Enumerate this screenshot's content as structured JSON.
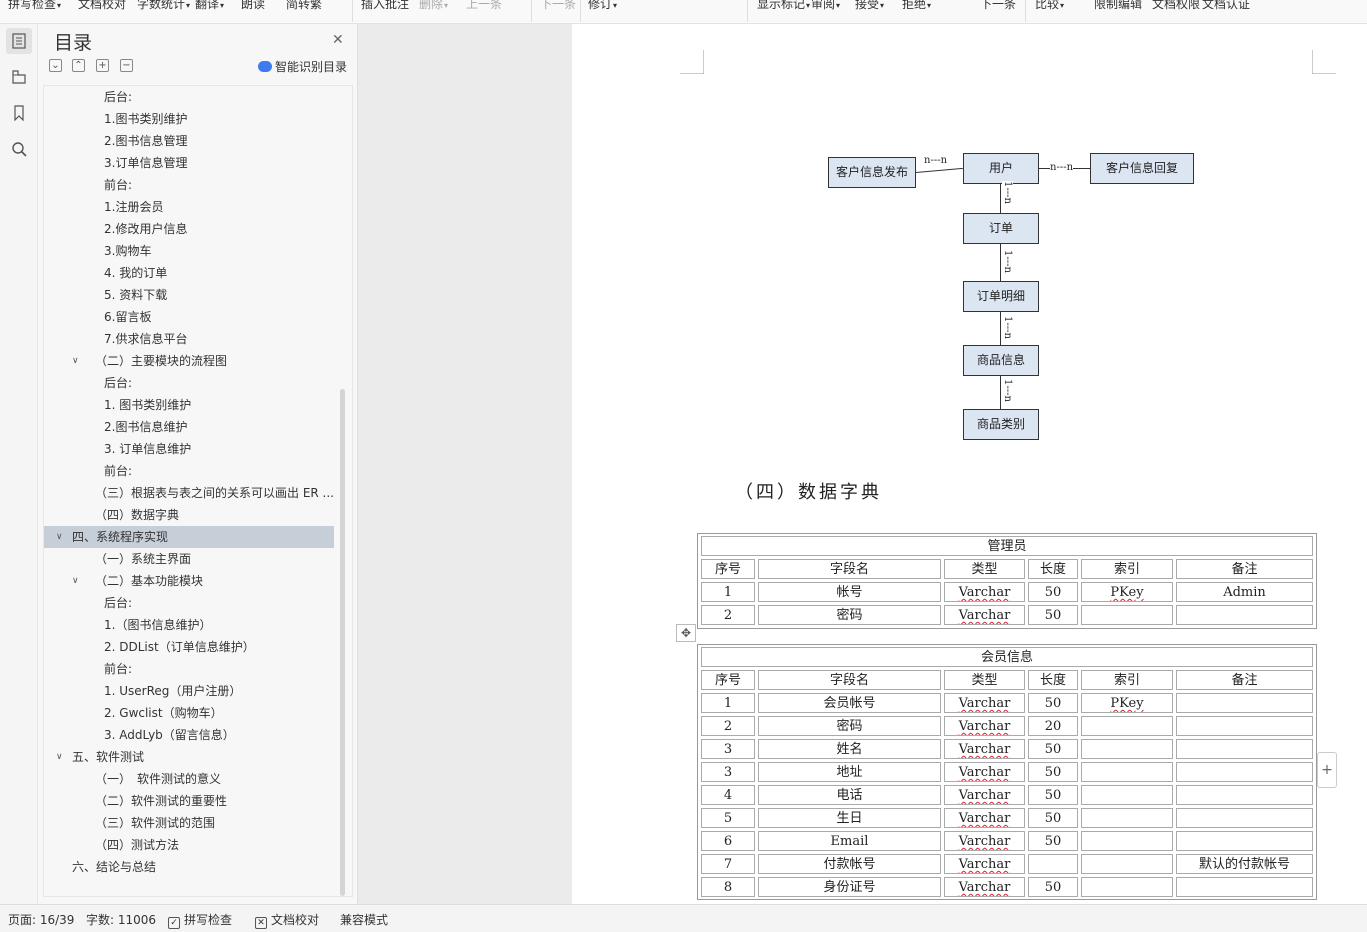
{
  "toolbar": {
    "items": [
      "拼写检查",
      "文档校对",
      "字数统计",
      "翻译",
      "朗读",
      "简转繁",
      "插入批注",
      "删除",
      "上一条",
      "下一条",
      "修订",
      "显示标记",
      "审阅",
      "接受",
      "拒绝",
      "下一条",
      "比较",
      "限制编辑",
      "文档权限",
      "文档认证"
    ]
  },
  "toc": {
    "title": "目录",
    "smart_label": "智能识别目录",
    "items": [
      {
        "text": "后台:",
        "level": 3
      },
      {
        "text": "1.图书类别维护",
        "level": 3
      },
      {
        "text": "2.图书信息管理",
        "level": 3
      },
      {
        "text": "3.订单信息管理",
        "level": 3
      },
      {
        "text": "前台:",
        "level": 3
      },
      {
        "text": "1.注册会员",
        "level": 3
      },
      {
        "text": "2.修改用户信息",
        "level": 3
      },
      {
        "text": "3.购物车",
        "level": 3
      },
      {
        "text": "4. 我的订单",
        "level": 3
      },
      {
        "text": "5. 资料下载",
        "level": 3
      },
      {
        "text": "6.留言板",
        "level": 3
      },
      {
        "text": "7.供求信息平台",
        "level": 3
      },
      {
        "text": "（二）主要模块的流程图",
        "level": 2,
        "expand": true
      },
      {
        "text": "后台:",
        "level": 3
      },
      {
        "text": "1. 图书类别维护",
        "level": 3
      },
      {
        "text": "2.图书信息维护",
        "level": 3
      },
      {
        "text": "3. 订单信息维护",
        "level": 3
      },
      {
        "text": "前台:",
        "level": 3
      },
      {
        "text": "（三）根据表与表之间的关系可以画出 ER ...",
        "level": 2
      },
      {
        "text": "（四）数据字典",
        "level": 2
      },
      {
        "text": "四、系统程序实现",
        "level": 1,
        "expand": true,
        "selected": true
      },
      {
        "text": "（一）系统主界面",
        "level": 2
      },
      {
        "text": "（二）基本功能模块",
        "level": 2,
        "expand": true
      },
      {
        "text": "后台:",
        "level": 3
      },
      {
        "text": "1.（图书信息维护）",
        "level": 3
      },
      {
        "text": "2. DDList（订单信息维护）",
        "level": 3
      },
      {
        "text": "前台:",
        "level": 3
      },
      {
        "text": "1. UserReg（用户注册）",
        "level": 3
      },
      {
        "text": "2. Gwclist（购物车）",
        "level": 3
      },
      {
        "text": "3. AddLyb（留言信息）",
        "level": 3
      },
      {
        "text": "五、软件测试",
        "level": 1,
        "expand": true
      },
      {
        "text": "（一）　软件测试的意义",
        "level": 2
      },
      {
        "text": "（二）软件测试的重要性",
        "level": 2
      },
      {
        "text": "（三）软件测试的范围",
        "level": 2
      },
      {
        "text": "（四）测试方法",
        "level": 2
      },
      {
        "text": "六、结论与总结",
        "level": 1
      }
    ]
  },
  "er": {
    "boxes": {
      "customer_post": "客户信息发布",
      "user": "用户",
      "customer_reply": "客户信息回复",
      "order": "订单",
      "order_detail": "订单明细",
      "product_info": "商品信息",
      "product_category": "商品类别"
    },
    "rel_nn": "n---n",
    "rel_1n": "1---n"
  },
  "section_heading": "（四）数据字典",
  "tables": [
    {
      "caption": "管理员",
      "headers": [
        "序号",
        "字段名",
        "类型",
        "长度",
        "索引",
        "备注"
      ],
      "rows": [
        [
          "1",
          "帐号",
          "Varchar",
          "50",
          "PKey",
          "Admin"
        ],
        [
          "2",
          "密码",
          "Varchar",
          "50",
          "",
          ""
        ]
      ]
    },
    {
      "caption": "会员信息",
      "headers": [
        "序号",
        "字段名",
        "类型",
        "长度",
        "索引",
        "备注"
      ],
      "rows": [
        [
          "1",
          "会员帐号",
          "Varchar",
          "50",
          "PKey",
          ""
        ],
        [
          "2",
          "密码",
          "Varchar",
          "20",
          "",
          ""
        ],
        [
          "3",
          "姓名",
          "Varchar",
          "50",
          "",
          ""
        ],
        [
          "3",
          "地址",
          "Varchar",
          "50",
          "",
          ""
        ],
        [
          "4",
          "电话",
          "Varchar",
          "50",
          "",
          ""
        ],
        [
          "5",
          "生日",
          "Varchar",
          "50",
          "",
          ""
        ],
        [
          "6",
          "Email",
          "Varchar",
          "50",
          "",
          ""
        ],
        [
          "7",
          "付款帐号",
          "Varchar",
          "",
          "",
          "默认的付款帐号"
        ],
        [
          "8",
          "身份证号",
          "Varchar",
          "50",
          "",
          ""
        ]
      ]
    }
  ],
  "status": {
    "page": "页面: 16/39",
    "words": "字数: 11006",
    "spell": "拼写检查",
    "proof": "文档校对",
    "compat": "兼容模式"
  }
}
